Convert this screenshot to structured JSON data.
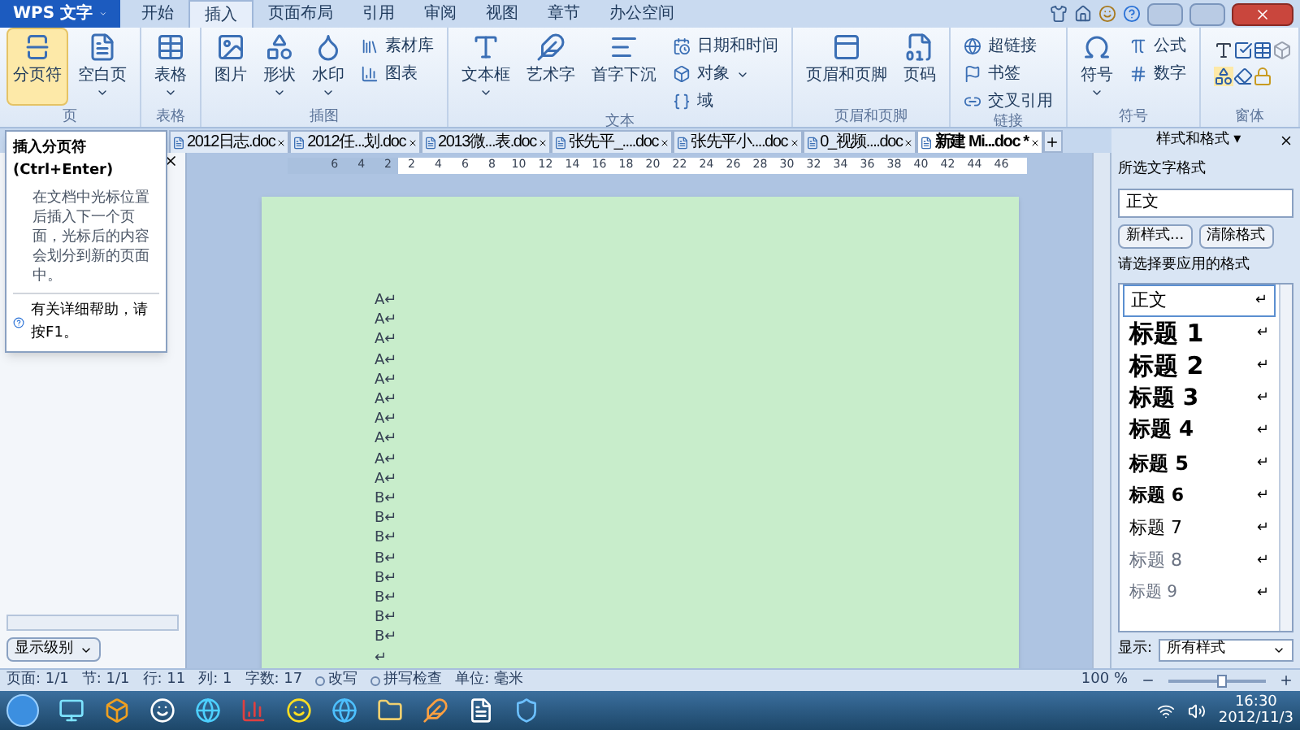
{
  "app_button": {
    "label": "WPS 文字"
  },
  "menu_tabs": [
    {
      "label": "开始",
      "selected": false
    },
    {
      "label": "插入",
      "selected": true
    },
    {
      "label": "页面布局",
      "selected": false
    },
    {
      "label": "引用",
      "selected": false
    },
    {
      "label": "审阅",
      "selected": false
    },
    {
      "label": "视图",
      "selected": false
    },
    {
      "label": "章节",
      "selected": false
    },
    {
      "label": "办公空间",
      "selected": false
    }
  ],
  "ribbon_groups": [
    {
      "label": "页",
      "buttons": [
        {
          "kind": "large",
          "label": "分页符",
          "selected": true,
          "dropdown": false
        },
        {
          "kind": "large",
          "label": "空白页",
          "selected": false,
          "dropdown": true
        }
      ]
    },
    {
      "label": "表格",
      "buttons": [
        {
          "kind": "large",
          "label": "表格",
          "selected": false,
          "dropdown": true
        }
      ]
    },
    {
      "label": "插图",
      "buttons": [
        {
          "kind": "large",
          "label": "图片",
          "selected": false,
          "dropdown": false
        },
        {
          "kind": "large",
          "label": "形状",
          "selected": false,
          "dropdown": true
        },
        {
          "kind": "large",
          "label": "水印",
          "selected": false,
          "dropdown": true
        },
        {
          "kind": "small",
          "label": "素材库",
          "selected": false,
          "dropdown": false
        },
        {
          "kind": "small",
          "label": "图表",
          "selected": false,
          "dropdown": false
        }
      ]
    },
    {
      "label": "文本",
      "buttons": [
        {
          "kind": "large",
          "label": "文本框",
          "selected": false,
          "dropdown": true
        },
        {
          "kind": "large",
          "label": "艺术字",
          "selected": false,
          "dropdown": false
        },
        {
          "kind": "large",
          "label": "首字下沉",
          "selected": false,
          "dropdown": false
        },
        {
          "kind": "small",
          "label": "日期和时间",
          "selected": false,
          "dropdown": false
        },
        {
          "kind": "small",
          "label": "对象",
          "selected": false,
          "dropdown": true
        },
        {
          "kind": "small",
          "label": "域",
          "selected": false,
          "dropdown": false
        }
      ]
    },
    {
      "label": "页眉和页脚",
      "buttons": [
        {
          "kind": "large",
          "label": "页眉和页脚",
          "selected": false,
          "dropdown": false
        },
        {
          "kind": "large",
          "label": "页码",
          "selected": false,
          "dropdown": false
        }
      ]
    },
    {
      "label": "链接",
      "buttons": [
        {
          "kind": "small",
          "label": "超链接",
          "selected": false,
          "dropdown": false
        },
        {
          "kind": "small",
          "label": "书签",
          "selected": false,
          "dropdown": false
        },
        {
          "kind": "small",
          "label": "交叉引用",
          "selected": false,
          "dropdown": false
        }
      ]
    },
    {
      "label": "符号",
      "buttons": [
        {
          "kind": "large",
          "label": "符号",
          "selected": false,
          "dropdown": true
        },
        {
          "kind": "small",
          "label": "公式",
          "selected": false,
          "dropdown": false
        },
        {
          "kind": "small",
          "label": "数字",
          "selected": false,
          "dropdown": false
        }
      ]
    },
    {
      "label": "窗体",
      "buttons": [
        {
          "kind": "icons",
          "selected": false
        }
      ]
    }
  ],
  "doc_tabs": [
    {
      "label": "2012日志.doc",
      "selected": false
    },
    {
      "label": "2012任...划.doc",
      "selected": false
    },
    {
      "label": "2013微...表.doc",
      "selected": false
    },
    {
      "label": "张先平_....doc",
      "selected": false
    },
    {
      "label": "张先平小....doc",
      "selected": false
    },
    {
      "label": "0_视频....doc",
      "selected": false
    },
    {
      "label": "新建 Mi...doc *",
      "selected": true
    }
  ],
  "tooltip": {
    "title": "插入分页符 (Ctrl+Enter)",
    "body": "在文档中光标位置后插入下一个页面，光标后的内容会划分到新的页面中。",
    "help": "有关详细帮助，请按F1。"
  },
  "left_pane": {
    "button": "显示级别"
  },
  "ruler": {
    "left_ticks": [
      "6",
      "4",
      "2"
    ],
    "ticks": [
      "2",
      "4",
      "6",
      "8",
      "10",
      "12",
      "14",
      "16",
      "18",
      "20",
      "22",
      "24",
      "26",
      "28",
      "30",
      "32",
      "34",
      "36",
      "38",
      "40",
      "42",
      "44",
      "46"
    ]
  },
  "document": {
    "lines": [
      "A↵",
      "A↵",
      "A↵",
      "A↵",
      "A↵",
      "A↵",
      "A↵",
      "A↵",
      "A↵",
      "A↵",
      "B↵",
      "B↵",
      "B↵",
      "B↵",
      "B↵",
      "B↵",
      "B↵",
      "B↵",
      "↵"
    ]
  },
  "styles_pane": {
    "title": "样式和格式",
    "title_caret": "▾",
    "selected_label": "所选文字格式",
    "selected_value": "正文",
    "new_button": "新样式...",
    "clear_button": "清除格式",
    "apply_label": "请选择要应用的格式",
    "styles": [
      {
        "label": "正文",
        "kind": "body",
        "mark": "↵",
        "selected": true
      },
      {
        "label": "标题 1",
        "kind": "h1",
        "mark": "↵",
        "selected": false
      },
      {
        "label": "标题 2",
        "kind": "h2",
        "mark": "↵",
        "selected": false
      },
      {
        "label": "标题 3",
        "kind": "h3",
        "mark": "↵",
        "selected": false
      },
      {
        "label": "标题 4",
        "kind": "h4",
        "mark": "↵",
        "selected": false
      },
      {
        "label": "标题 5",
        "kind": "h5",
        "mark": "↵",
        "selected": false
      },
      {
        "label": "标题 6",
        "kind": "h6",
        "mark": "↵",
        "selected": false
      },
      {
        "label": "标题 7",
        "kind": "h7",
        "mark": "↵",
        "selected": false
      },
      {
        "label": "标题 8",
        "kind": "h8",
        "mark": "↵",
        "selected": false
      },
      {
        "label": "标题 9",
        "kind": "h9",
        "mark": "↵",
        "selected": false
      }
    ],
    "show_label": "显示:",
    "show_value": "所有样式"
  },
  "status_bar": {
    "items": [
      "页面: 1/1",
      "节: 1/1",
      "行: 11",
      "列: 1",
      "字数: 17"
    ],
    "toggles": [
      {
        "label": "改写",
        "on": false
      },
      {
        "label": "拼写检查",
        "on": false
      }
    ],
    "unit": "单位: 毫米",
    "zoom": "100 %",
    "zoom_level": {
      "level": 0.55
    }
  },
  "taskbar": {
    "time": "16:30",
    "date": "2012/11/3"
  }
}
